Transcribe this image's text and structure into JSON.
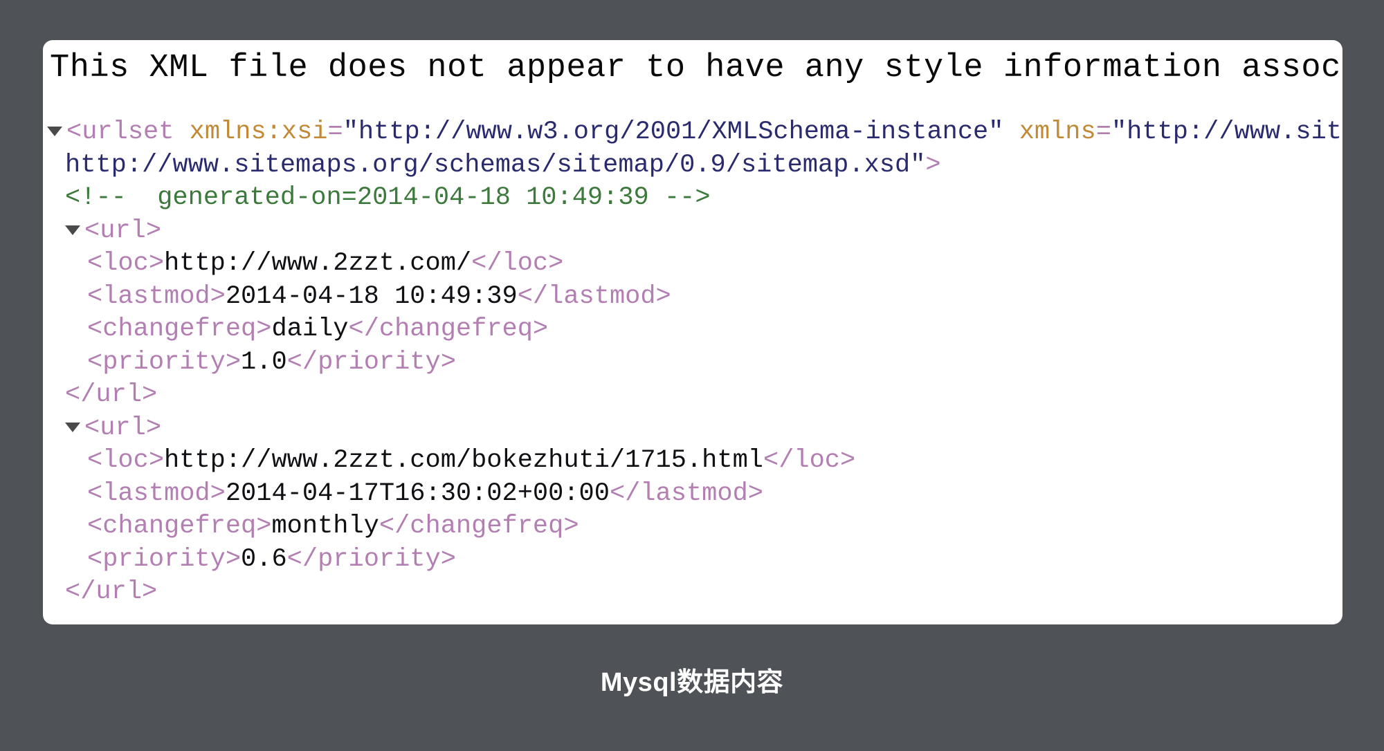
{
  "page": {
    "background_color": "#4f5257",
    "panel_background": "#ffffff"
  },
  "notice": {
    "text": "This XML file does not appear to have any style information associated with"
  },
  "colors": {
    "tag": "#b37fb3",
    "attribute": "#c08a36",
    "value": "#2a2a6e",
    "comment": "#3c7a3c",
    "text": "#101014",
    "rule": "#000000"
  },
  "xml": {
    "lines": [
      {
        "id": "urlset-open",
        "twisty": true,
        "indent": 0,
        "segments": [
          {
            "kind": "tag",
            "text": "<urlset "
          },
          {
            "kind": "attr",
            "text": "xmlns:xsi"
          },
          {
            "kind": "tag",
            "text": "="
          },
          {
            "kind": "val",
            "text": "\"http://www.w3.org/2001/XMLSchema-instance\""
          },
          {
            "kind": "text",
            "text": " "
          },
          {
            "kind": "attr",
            "text": "xmlns"
          },
          {
            "kind": "tag",
            "text": "="
          },
          {
            "kind": "val",
            "text": "\"http://www.siter"
          }
        ]
      },
      {
        "id": "urlset-open-wrap",
        "twisty": false,
        "indent": 0,
        "continuation": true,
        "segments": [
          {
            "kind": "val",
            "text": "http://www.sitemaps.org/schemas/sitemap/0.9/sitemap.xsd\""
          },
          {
            "kind": "tag",
            "text": ">"
          }
        ]
      },
      {
        "id": "generated-comment",
        "twisty": false,
        "indent": 1,
        "segments": [
          {
            "kind": "comment",
            "text": "<!--  generated-on=2014-04-18 10:49:39 -->"
          }
        ]
      },
      {
        "id": "url-open-1",
        "twisty": true,
        "indent": 1,
        "segments": [
          {
            "kind": "tag",
            "text": "<url>"
          }
        ]
      },
      {
        "id": "loc-1",
        "twisty": false,
        "indent": 2,
        "segments": [
          {
            "kind": "tag",
            "text": "<loc>"
          },
          {
            "kind": "text",
            "text": "http://www.2zzt.com/"
          },
          {
            "kind": "tag",
            "text": "</loc>"
          }
        ]
      },
      {
        "id": "lastmod-1",
        "twisty": false,
        "indent": 2,
        "segments": [
          {
            "kind": "tag",
            "text": "<lastmod>"
          },
          {
            "kind": "text",
            "text": "2014-04-18 10:49:39"
          },
          {
            "kind": "tag",
            "text": "</lastmod>"
          }
        ]
      },
      {
        "id": "changefreq-1",
        "twisty": false,
        "indent": 2,
        "segments": [
          {
            "kind": "tag",
            "text": "<changefreq>"
          },
          {
            "kind": "text",
            "text": "daily"
          },
          {
            "kind": "tag",
            "text": "</changefreq>"
          }
        ]
      },
      {
        "id": "priority-1",
        "twisty": false,
        "indent": 2,
        "segments": [
          {
            "kind": "tag",
            "text": "<priority>"
          },
          {
            "kind": "text",
            "text": "1.0"
          },
          {
            "kind": "tag",
            "text": "</priority>"
          }
        ]
      },
      {
        "id": "url-close-1",
        "twisty": false,
        "indent": 1,
        "segments": [
          {
            "kind": "tag",
            "text": "</url>"
          }
        ]
      },
      {
        "id": "url-open-2",
        "twisty": true,
        "indent": 1,
        "segments": [
          {
            "kind": "tag",
            "text": "<url>"
          }
        ]
      },
      {
        "id": "loc-2",
        "twisty": false,
        "indent": 2,
        "segments": [
          {
            "kind": "tag",
            "text": "<loc>"
          },
          {
            "kind": "text",
            "text": "http://www.2zzt.com/bokezhuti/1715.html"
          },
          {
            "kind": "tag",
            "text": "</loc>"
          }
        ]
      },
      {
        "id": "lastmod-2",
        "twisty": false,
        "indent": 2,
        "segments": [
          {
            "kind": "tag",
            "text": "<lastmod>"
          },
          {
            "kind": "text",
            "text": "2014-04-17T16:30:02+00:00"
          },
          {
            "kind": "tag",
            "text": "</lastmod>"
          }
        ]
      },
      {
        "id": "changefreq-2",
        "twisty": false,
        "indent": 2,
        "segments": [
          {
            "kind": "tag",
            "text": "<changefreq>"
          },
          {
            "kind": "text",
            "text": "monthly"
          },
          {
            "kind": "tag",
            "text": "</changefreq>"
          }
        ]
      },
      {
        "id": "priority-2",
        "twisty": false,
        "indent": 2,
        "segments": [
          {
            "kind": "tag",
            "text": "<priority>"
          },
          {
            "kind": "text",
            "text": "0.6"
          },
          {
            "kind": "tag",
            "text": "</priority>"
          }
        ]
      },
      {
        "id": "url-close-2",
        "twisty": false,
        "indent": 1,
        "segments": [
          {
            "kind": "tag",
            "text": "</url>"
          }
        ]
      }
    ]
  },
  "caption": {
    "text": "Mysql数据内容"
  }
}
